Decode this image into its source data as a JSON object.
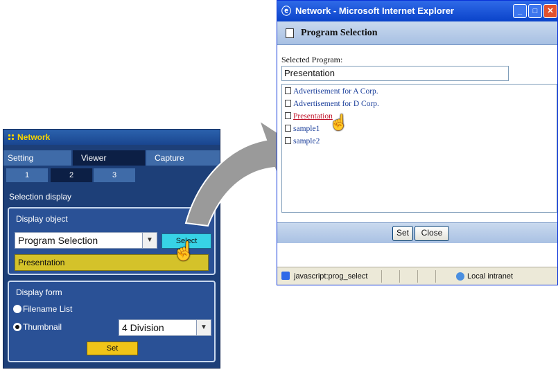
{
  "left_panel": {
    "title": "Network",
    "tabs": [
      "Setting",
      "Viewer",
      "Capture"
    ],
    "subtabs": [
      "1",
      "2",
      "3"
    ],
    "section_title": "Selection display",
    "display_object": {
      "label": "Display object",
      "dropdown_value": "Program Selection",
      "select_button": "Select",
      "selected_value": "Presentation"
    },
    "display_form": {
      "label": "Display form",
      "options": [
        "Filename List",
        "Thumbnail"
      ],
      "selected_option": "Thumbnail",
      "division_value": "4 Division",
      "set_button": "Set"
    }
  },
  "ie_window": {
    "title": "Network - Microsoft Internet Explorer",
    "header": "Program Selection",
    "selected_program_label": "Selected Program:",
    "selected_program_value": "Presentation",
    "programs": [
      "Advertisement for A Corp.",
      "Advertisement for D Corp.",
      "Presentation",
      "sample1",
      "sample2"
    ],
    "active_program": "Presentation",
    "buttons": {
      "set": "Set",
      "close": "Close"
    },
    "status_text": "javascript:prog_select",
    "zone_text": "Local intranet"
  },
  "colors": {
    "panel_bg": "#1d3f78",
    "select_button": "#37d3e6",
    "highlight_bar": "#d4c22a",
    "set_button": "#f0c418",
    "ie_titlebar": "#0a43c9",
    "link": "#1a3e9a",
    "active_link": "#c0142a"
  },
  "icons": [
    "hand-pointer-icon",
    "ie-logo-icon",
    "document-icon",
    "globe-icon"
  ]
}
